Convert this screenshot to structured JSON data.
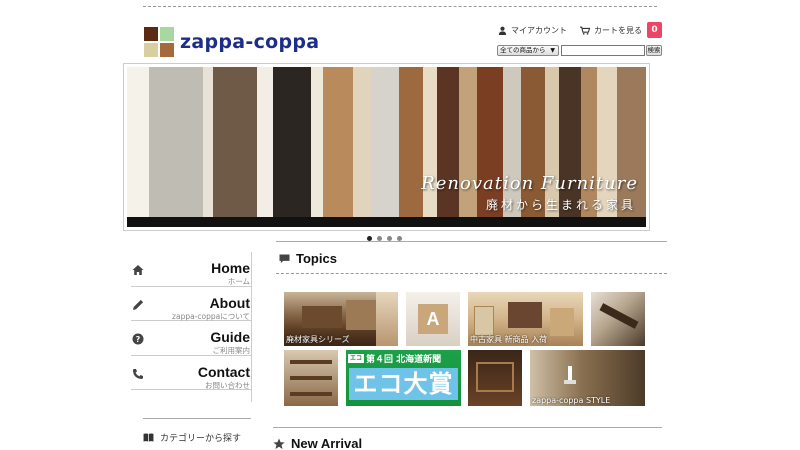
{
  "header": {
    "logo_text": "zappa-coppa",
    "logo_colors": [
      "#5a2a12",
      "#a8d8a0",
      "#d8cfa0",
      "#a56a3c"
    ],
    "account_label": "マイアカウント",
    "cart_label": "カートを見る",
    "cart_count": "0",
    "cart_badge_color": "#ee4466",
    "search": {
      "category_selected": "全ての商品から",
      "input_value": "",
      "button_label": "検索"
    }
  },
  "hero": {
    "title": "Renovation Furniture",
    "subtitle": "廃材から生まれる家具",
    "slide_count": 4,
    "active_slide": 1
  },
  "sidebar": {
    "items": [
      {
        "label": "Home",
        "sub": "ホーム",
        "icon": "home-icon"
      },
      {
        "label": "About",
        "sub": "zappa-coppaについて",
        "icon": "pencil-icon"
      },
      {
        "label": "Guide",
        "sub": "ご利用案内",
        "icon": "help-icon"
      },
      {
        "label": "Contact",
        "sub": "お問い合わせ",
        "icon": "phone-icon"
      }
    ],
    "category_browse": "カテゴリーから探す"
  },
  "topics": {
    "title": "Topics",
    "tiles": [
      {
        "caption": "廃材家具シリーズ"
      },
      {
        "caption": ""
      },
      {
        "caption": "中古家具 新商品 入荷"
      },
      {
        "caption": ""
      },
      {
        "caption": ""
      },
      {
        "caption": ""
      },
      {
        "caption": "zappa-coppa STYLE"
      }
    ],
    "eco_award": {
      "header": "第４回 北海道新聞",
      "badge": "エコ",
      "big": "エコ大賞"
    }
  },
  "new_arrival": {
    "title": "New Arrival"
  }
}
